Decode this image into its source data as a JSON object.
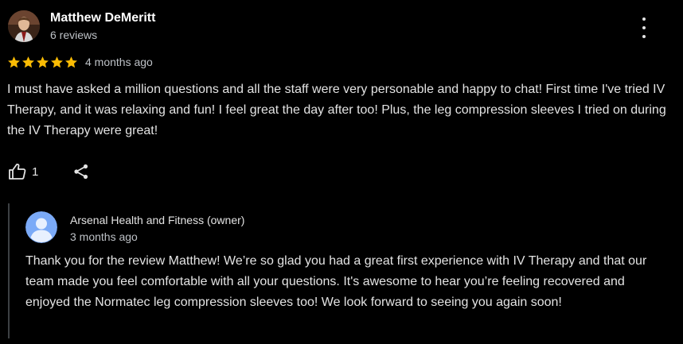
{
  "review": {
    "author_name": "Matthew DeMeritt",
    "review_count": "6 reviews",
    "rating": 5,
    "time": "4 months ago",
    "text": "I must have asked a million questions and all the staff were very personable and happy to chat! First time I've tried IV Therapy, and it was relaxing and fun! I feel great the day after too! Plus, the leg compression sleeves I tried on during the IV Therapy were great!",
    "like_count": "1",
    "icons": {
      "avatar": "profile-photo",
      "more": "more-vert-icon",
      "star": "star-icon",
      "like": "thumb-up-icon",
      "share": "share-icon"
    }
  },
  "reply": {
    "owner_name": "Arsenal Health and Fitness (owner)",
    "time": "3 months ago",
    "text": "Thank you for the review Matthew! We’re so glad you had a great first experience with IV Therapy and that our team made you feel comfortable with all your questions. It's awesome to hear you’re feeling recovered and enjoyed the Normatec leg compression sleeves too! We look forward to seeing you again soon!",
    "icons": {
      "avatar": "default-person-avatar"
    }
  },
  "colors": {
    "background": "#000000",
    "text": "#e3e3e3",
    "secondary_text": "#bdc1c6",
    "star": "#fbbc04",
    "reply_border": "#3c4043",
    "owner_avatar_bg": "#7baaf7"
  }
}
